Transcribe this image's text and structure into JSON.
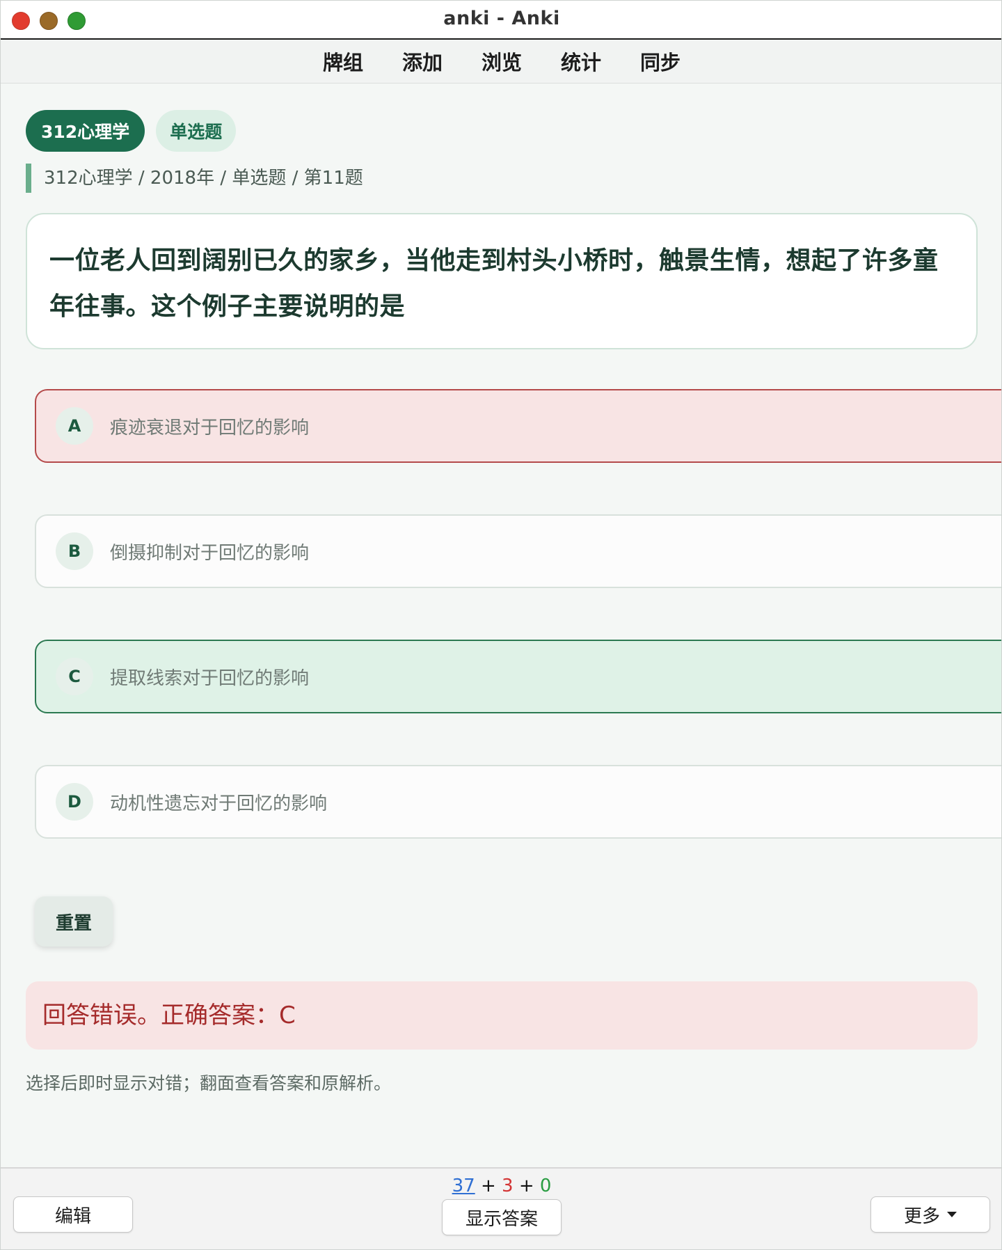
{
  "window": {
    "title": "anki - Anki"
  },
  "nav": {
    "items": [
      "牌组",
      "添加",
      "浏览",
      "统计",
      "同步"
    ]
  },
  "tags": {
    "subject": "312心理学",
    "type": "单选题"
  },
  "breadcrumb": "312心理学 / 2018年 / 单选题 / 第11题",
  "question": {
    "text": "一位老人回到阔别已久的家乡，当他走到村头小桥时，触景生情，想起了许多童年往事。这个例子主要说明的是"
  },
  "options": [
    {
      "letter": "A",
      "text": "痕迹衰退对于回忆的影响",
      "state": "wrong"
    },
    {
      "letter": "B",
      "text": "倒摄抑制对于回忆的影响",
      "state": "neutral"
    },
    {
      "letter": "C",
      "text": "提取线索对于回忆的影响",
      "state": "correct"
    },
    {
      "letter": "D",
      "text": "动机性遗忘对于回忆的影响",
      "state": "neutral"
    }
  ],
  "reset_label": "重置",
  "feedback": "回答错误。正确答案：C",
  "hint": "选择后即时显示对错；翻面查看答案和原解析。",
  "bottom": {
    "edit_label": "编辑",
    "show_answer_label": "显示答案",
    "more_label": "更多",
    "counts": {
      "new": "37",
      "learn": "3",
      "review": "0"
    }
  },
  "colors": {
    "accent": "#1c6e4f",
    "wrong_bg": "#f8e4e4",
    "wrong_border": "#b44a4a",
    "correct_bg": "#dff2e7",
    "correct_border": "#2c7a52"
  }
}
